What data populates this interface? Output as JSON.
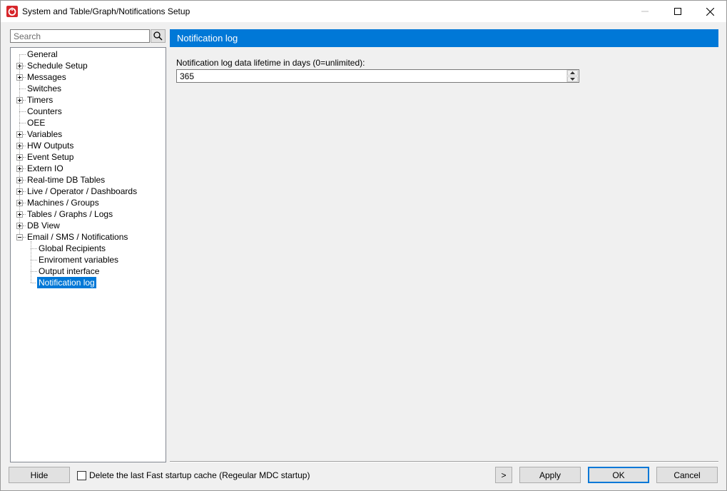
{
  "window": {
    "title": "System and Table/Graph/Notifications Setup",
    "accent_color": "#0078d7",
    "app_icon": "app-logo-icon"
  },
  "search": {
    "placeholder": "Search",
    "value": ""
  },
  "tree": {
    "items": [
      {
        "label": "General",
        "level": 0,
        "expander": "none"
      },
      {
        "label": "Schedule Setup",
        "level": 0,
        "expander": "plus"
      },
      {
        "label": "Messages",
        "level": 0,
        "expander": "plus"
      },
      {
        "label": "Switches",
        "level": 0,
        "expander": "none"
      },
      {
        "label": "Timers",
        "level": 0,
        "expander": "plus"
      },
      {
        "label": "Counters",
        "level": 0,
        "expander": "none"
      },
      {
        "label": "OEE",
        "level": 0,
        "expander": "none"
      },
      {
        "label": "Variables",
        "level": 0,
        "expander": "plus"
      },
      {
        "label": "HW Outputs",
        "level": 0,
        "expander": "plus"
      },
      {
        "label": "Event Setup",
        "level": 0,
        "expander": "plus"
      },
      {
        "label": "Extern IO",
        "level": 0,
        "expander": "plus"
      },
      {
        "label": "Real-time DB Tables",
        "level": 0,
        "expander": "plus"
      },
      {
        "label": "Live / Operator / Dashboards",
        "level": 0,
        "expander": "plus"
      },
      {
        "label": "Machines / Groups",
        "level": 0,
        "expander": "plus"
      },
      {
        "label": "Tables / Graphs / Logs",
        "level": 0,
        "expander": "plus"
      },
      {
        "label": "DB View",
        "level": 0,
        "expander": "plus"
      },
      {
        "label": "Email / SMS / Notifications",
        "level": 0,
        "expander": "minus"
      },
      {
        "label": "Global Recipients",
        "level": 1,
        "expander": "none"
      },
      {
        "label": "Enviroment variables",
        "level": 1,
        "expander": "none"
      },
      {
        "label": "Output interface",
        "level": 1,
        "expander": "none"
      },
      {
        "label": "Notification log",
        "level": 1,
        "expander": "none",
        "selected": true
      }
    ]
  },
  "panel": {
    "header": "Notification log",
    "field_label": "Notification log data lifetime in days (0=unlimited):",
    "field_value": "365"
  },
  "footer": {
    "hide_label": "Hide",
    "checkbox_label": "Delete the last Fast startup cache (Regeular MDC startup)",
    "checkbox_checked": false,
    "more_label": ">",
    "apply_label": "Apply",
    "ok_label": "OK",
    "cancel_label": "Cancel"
  }
}
